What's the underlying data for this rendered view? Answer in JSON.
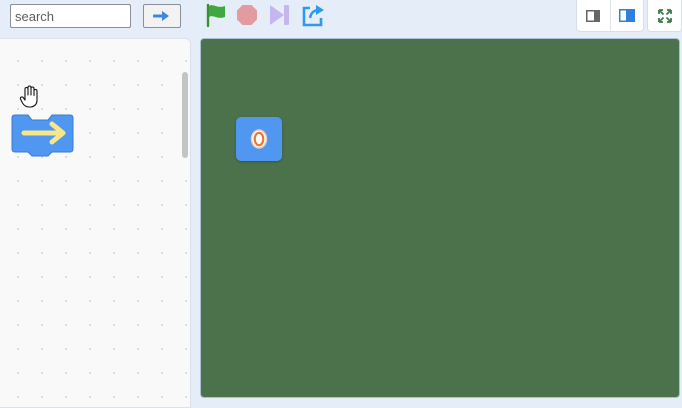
{
  "toolbar": {
    "search_placeholder": "search",
    "search_value": "",
    "go_icon": "arrow-right-icon",
    "run_icon": "green-flag-icon",
    "stop_icon": "stop-icon",
    "step_icon": "step-forward-icon",
    "share_icon": "share-icon"
  },
  "view_controls": {
    "small_stage_icon": "small-stage-icon",
    "large_stage_icon": "large-stage-icon",
    "fullscreen_icon": "fullscreen-icon"
  },
  "workspace": {
    "block_icon": "arrow-right-icon",
    "cursor_icon": "grab-hand-icon"
  },
  "stage": {
    "sprite_icon": "target-icon",
    "sprite_label": "0"
  },
  "colors": {
    "stage_background": "#4b724a",
    "block_blue": "#4f97f0",
    "arrow_yellow": "#f7e78a",
    "flag_green": "#3fa93f",
    "stop_red": "#e39aa0",
    "step_purple": "#c5b6f2",
    "share_blue": "#2d9bea"
  }
}
